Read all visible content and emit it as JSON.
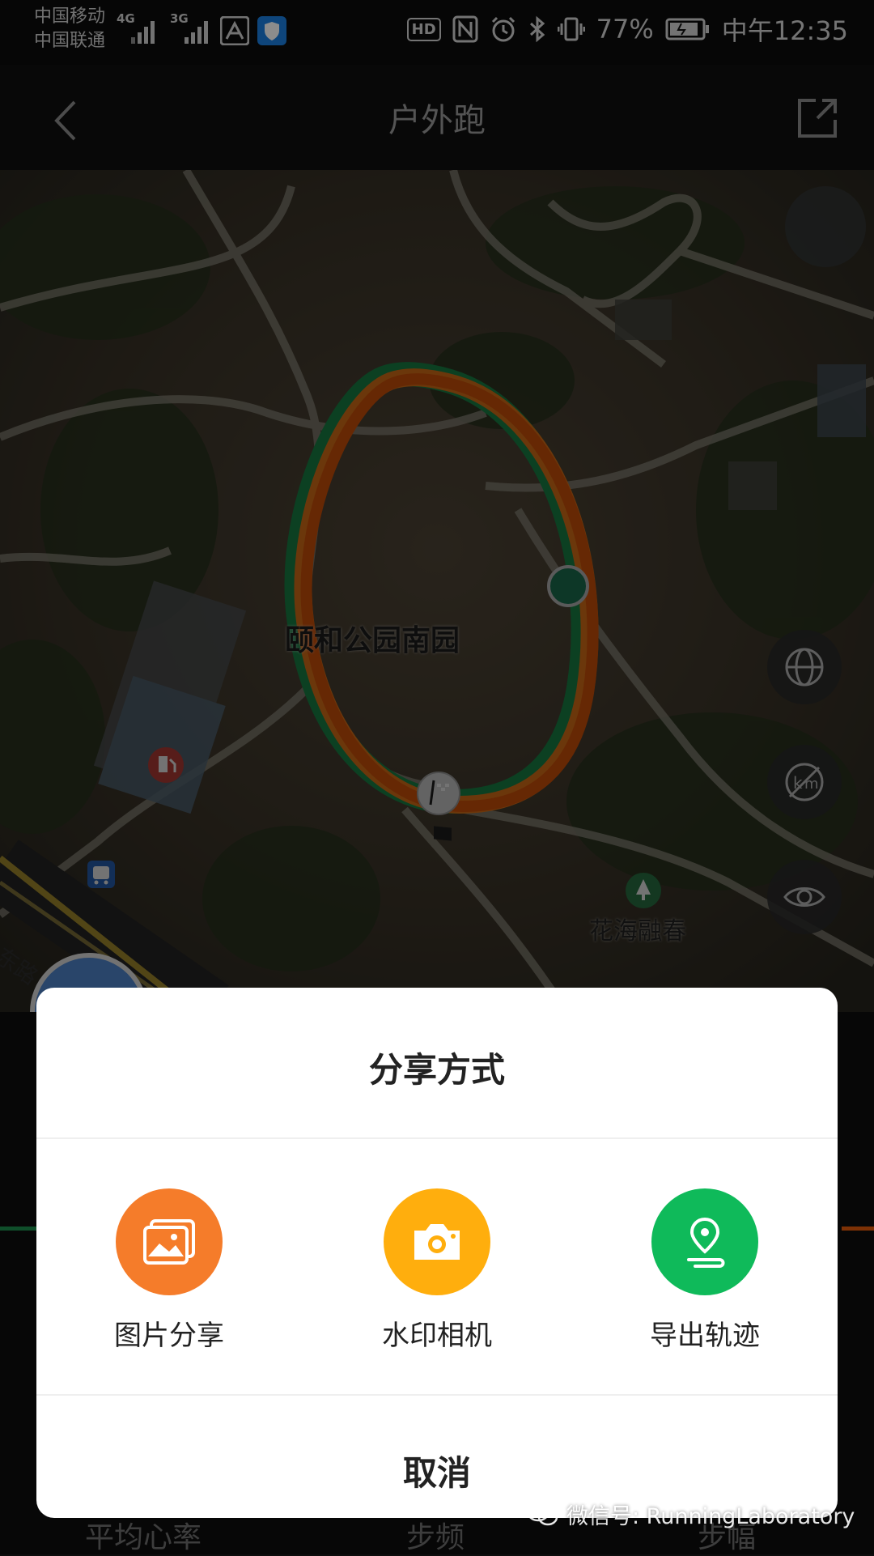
{
  "status_bar": {
    "carrier_1": "中国移动",
    "carrier_2": "中国联通",
    "net_1": "4G",
    "net_2": "3G",
    "hd_badge": "HD",
    "battery": "77%",
    "time": "中午12:35"
  },
  "header": {
    "title": "户外跑"
  },
  "map": {
    "park_label": "颐和公园南园",
    "place_label": "花海融春",
    "road_label": "东路",
    "track_colors": [
      "#1d8f4e",
      "#f07b1a",
      "#e45a0a"
    ]
  },
  "stats_labels": {
    "heart_rate": "平均心率",
    "cadence": "步频",
    "stride": "步幅"
  },
  "share_dialog": {
    "title": "分享方式",
    "options": [
      {
        "label": "图片分享",
        "icon": "image-share-icon",
        "color": "#f57c2a"
      },
      {
        "label": "水印相机",
        "icon": "camera-icon",
        "color": "#ffae0d"
      },
      {
        "label": "导出轨迹",
        "icon": "location-route-icon",
        "color": "#0fba5a"
      }
    ],
    "cancel": "取消"
  },
  "watermark": {
    "text": "微信号: RunningLaboratory"
  }
}
